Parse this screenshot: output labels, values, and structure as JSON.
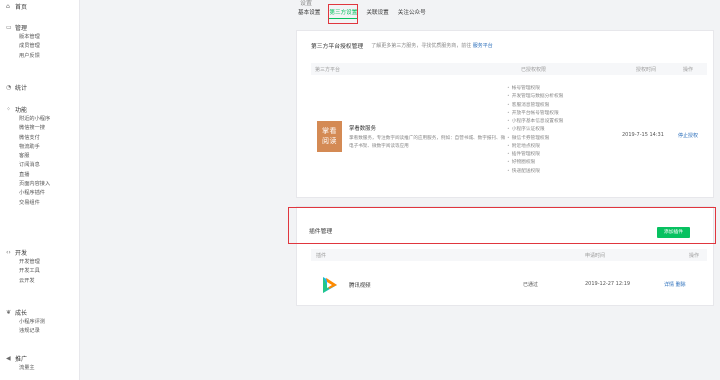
{
  "sidebar": {
    "home": "首页",
    "manage": {
      "label": "管理",
      "items": [
        "版本管理",
        "成员管理",
        "用户反馈"
      ]
    },
    "stats": "统计",
    "features": {
      "label": "功能",
      "items": [
        "附近的小程序",
        "微信搜一搜",
        "微信支付",
        "物流助手",
        "客服",
        "订阅消息",
        "直播",
        "页面内容接入",
        "小程序插件",
        "交易组件"
      ]
    },
    "dev": {
      "label": "开发",
      "items": [
        "开发管理",
        "开发工具",
        "云开发"
      ]
    },
    "growth": {
      "label": "成长",
      "items": [
        "小程序评测",
        "违规记录"
      ]
    },
    "promo": {
      "label": "推广",
      "items": [
        "流量主"
      ]
    }
  },
  "main": {
    "section_title": "设置",
    "tabs": [
      "基本设置",
      "第三方设置",
      "关联设置",
      "关注公众号"
    ],
    "third_party": {
      "title": "第三方平台授权管理",
      "desc": "了解更多第三方服务，寻找优质服务商，前往",
      "desc_link": "服务平台",
      "columns": [
        "第三方平台",
        "已授权权限",
        "授权时间",
        "操作"
      ],
      "row": {
        "logo_text": "掌看\n阅读",
        "name": "掌看数服务",
        "desc": "掌看数服务，专注数字阅读推广的应用服务，例如：自营书城、数字报刊、微电子书架、微数字阅读等应用",
        "permissions": [
          "帐号管理权限",
          "开发管理与数据分析权限",
          "客服消息管理权限",
          "开放平台帐号管理权限",
          "小程序基本信息设置权限",
          "小程序认证权限",
          "微信卡券管理权限",
          "附近地点权限",
          "插件管理权限",
          "好物圈权限",
          "快递配送权限"
        ],
        "time": "2019-7-15 14:31",
        "action": "停止授权"
      }
    },
    "plugins": {
      "title": "插件管理",
      "add_button": "添加插件",
      "columns": [
        "插件",
        "申请时间",
        "操作"
      ],
      "row": {
        "name": "腾讯视频",
        "status": "已通过",
        "time": "2019-12-27 12:19",
        "actions": [
          "详情",
          "删除"
        ]
      }
    }
  },
  "colors": {
    "accent": "#07c160",
    "highlight": "#e0363e",
    "link": "#2a6ebb"
  }
}
